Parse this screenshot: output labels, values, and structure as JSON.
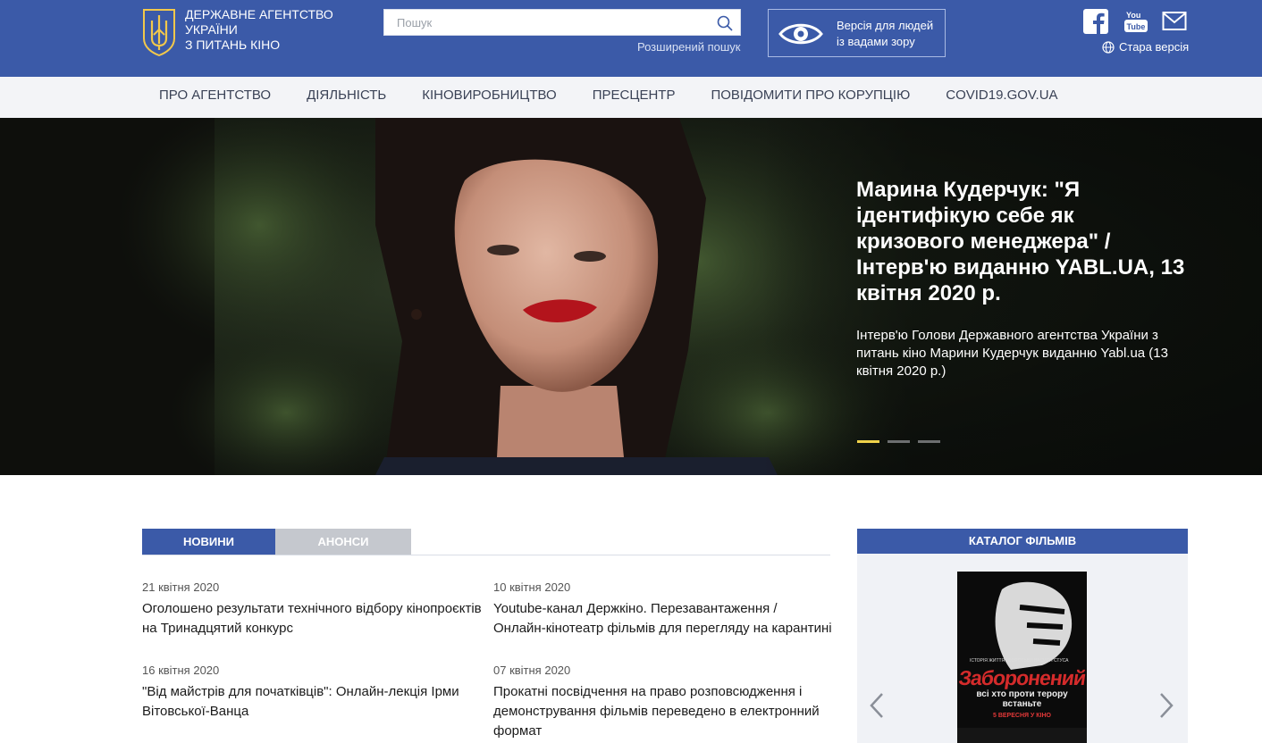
{
  "header": {
    "agency_line1": "ДЕРЖАВНЕ АГЕНТСТВО",
    "agency_line2": "УКРАЇНИ",
    "agency_line3": "З ПИТАНЬ КІНО",
    "search_placeholder": "Пошук",
    "advanced_search": "Розширений пошук",
    "vision_line1": "Версія для людей",
    "vision_line2": "із вадами зору",
    "old_version": "Стара версія",
    "social": [
      "facebook-icon",
      "youtube-icon",
      "mail-icon"
    ],
    "bg_color": "#3b5aa8"
  },
  "nav": {
    "items": [
      "ПРО АГЕНТСТВО",
      "ДІЯЛЬНІСТЬ",
      "КІНОВИРОБНИЦТВО",
      "ПРЕСЦЕНТР",
      "ПОВІДОМИТИ ПРО КОРУПЦІЮ",
      "COVID19.GOV.UA"
    ]
  },
  "hero": {
    "title": "Марина Кудерчук: \"Я ідентифікую себе як кризового менеджера\" / Інтерв'ю виданню YABL.UA, 13 квітня 2020 р.",
    "description": "Інтерв'ю Голови Державного агентства України з питань кіно Марини Кудерчук виданню Yabl.ua (13 квітня 2020 р.)",
    "slides_total": 3,
    "active_slide": 1,
    "accent_color": "#f0d24a"
  },
  "tabs": {
    "news": "НОВИНИ",
    "announcements": "АНОНСИ"
  },
  "news": [
    {
      "date": "21 квітня 2020",
      "title": "Оголошено результати технічного відбору кінопроєктів на Тринадцятий конкурс"
    },
    {
      "date": "10 квітня 2020",
      "title": "Youtube-канал Держкіно. Перезавантаження / Онлайн-кінотеатр фільмів для перегляду на карантині"
    },
    {
      "date": "16 квітня 2020",
      "title": "\"Від майстрів для початківців\": Онлайн-лекція Ірми Вітовської-Ванца"
    },
    {
      "date": "07 квітня 2020",
      "title": "Прокатні посвідчення на право розповсюдження і демонстрування фільмів переведено в електронний формат"
    }
  ],
  "catalog": {
    "heading": "КАТАЛОГ ФІЛЬМІВ",
    "poster_title": "Заборонений",
    "poster_small": "ІСТОРІЯ ЖИТТЯ І БОРОТЬБИ ВАСИЛЯ СТУСА",
    "poster_tagline": "всі хто проти терору встаньте",
    "poster_date": "5 ВЕРЕСНЯ У КІНО"
  }
}
